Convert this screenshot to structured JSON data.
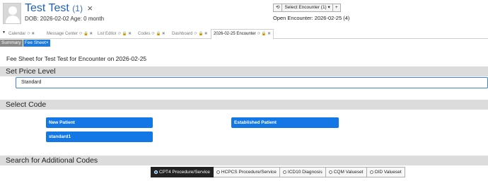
{
  "patient": {
    "name": "Test Test",
    "count": "(1)",
    "close": "×",
    "dob_age": "DOB: 2026-02-02 Age: 0 month"
  },
  "encounter": {
    "refresh_icon": "⟲",
    "select_label": "Select Encounter",
    "select_count": "(1)",
    "caret": "▾",
    "add": "+",
    "open_text": "Open Encounter: 2026-02-25 (4)"
  },
  "tabs": [
    {
      "label": "Calendar",
      "icons": "⟳ ✖"
    },
    {
      "label": "Message Center",
      "icons": "⟳ 🔒 ✖"
    },
    {
      "label": "List Editor",
      "icons": "⟳ 🔒 ✖"
    },
    {
      "label": "Codes",
      "icons": "⟳ 🔒 ✖"
    },
    {
      "label": "Dashboard",
      "icons": "⟳ 🔒 ✖"
    },
    {
      "label": "2026-02-25 Encounter",
      "icons": "⟳ 🔒 ✖"
    }
  ],
  "subtabs": {
    "summary": "Summary",
    "fee_sheet": "Fee Sheet",
    "close": "×"
  },
  "fee_sheet_title": "Fee Sheet for Test Test for Encounter on 2026-02-25",
  "sections": {
    "price_level": "Set Price Level",
    "select_code": "Select Code",
    "search": "Search for Additional Codes"
  },
  "price_level_value": "Standard",
  "code_buttons": {
    "new_patient": "New Patient",
    "established_patient": "Established Patient",
    "standard1": "standard1"
  },
  "search_options": [
    "CPT4 Procedure/Service",
    "HCPCS Procedure/Service",
    "ICD10 Diagnosis",
    "CQM Valueset",
    "OID Valueset"
  ],
  "colors": {
    "accent": "#1477e6",
    "section_bg": "#dcdcdc",
    "patient_name": "#1f5fbf"
  }
}
